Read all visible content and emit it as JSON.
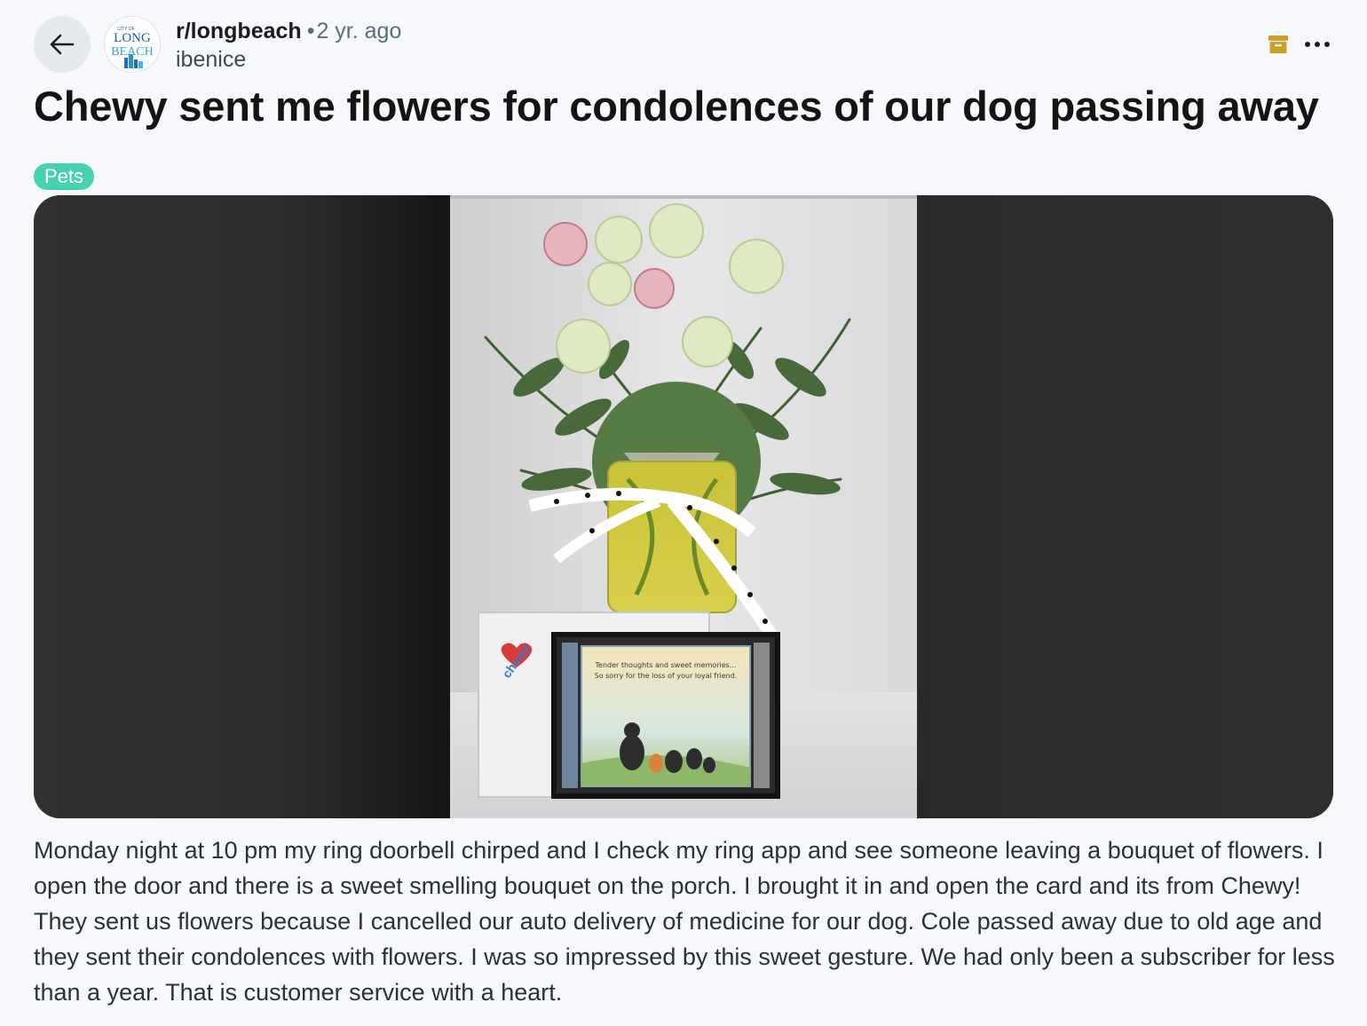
{
  "header": {
    "back_icon": "arrow-left-icon",
    "subreddit": "r/longbeach",
    "separator": "•",
    "age": "2 yr. ago",
    "author": "ibenice",
    "avatar": {
      "small_text": "CITY OF",
      "word1": "LONG",
      "word2": "BEACH"
    },
    "archive_icon": "archive-icon",
    "more_icon": "more-options-icon"
  },
  "post": {
    "title": "Chewy sent me flowers for condolences of our dog passing away",
    "flair": "Pets",
    "body": "Monday night at 10 pm my ring doorbell chirped and I check my ring app and see someone leaving a bouquet of flowers. I open the door and there is a sweet smelling bouquet on the porch. I brought it in and open the card and its from Chewy! They sent us flowers because I cancelled our auto delivery of medicine for our dog. Cole passed away due to old age and they sent their condolences with flowers. I was so impressed by this sweet gesture. We had only been a subscriber for less than a year. That is customer service with a heart.",
    "image": {
      "envelope_logo": "chewy",
      "card_line1": "Tender thoughts and sweet memories...",
      "card_line2": "So sorry for the loss of your loyal friend."
    }
  },
  "colors": {
    "flair_bg": "#46d1b2",
    "archive_icon": "#c9a227",
    "page_bg": "#f6f8fb"
  }
}
